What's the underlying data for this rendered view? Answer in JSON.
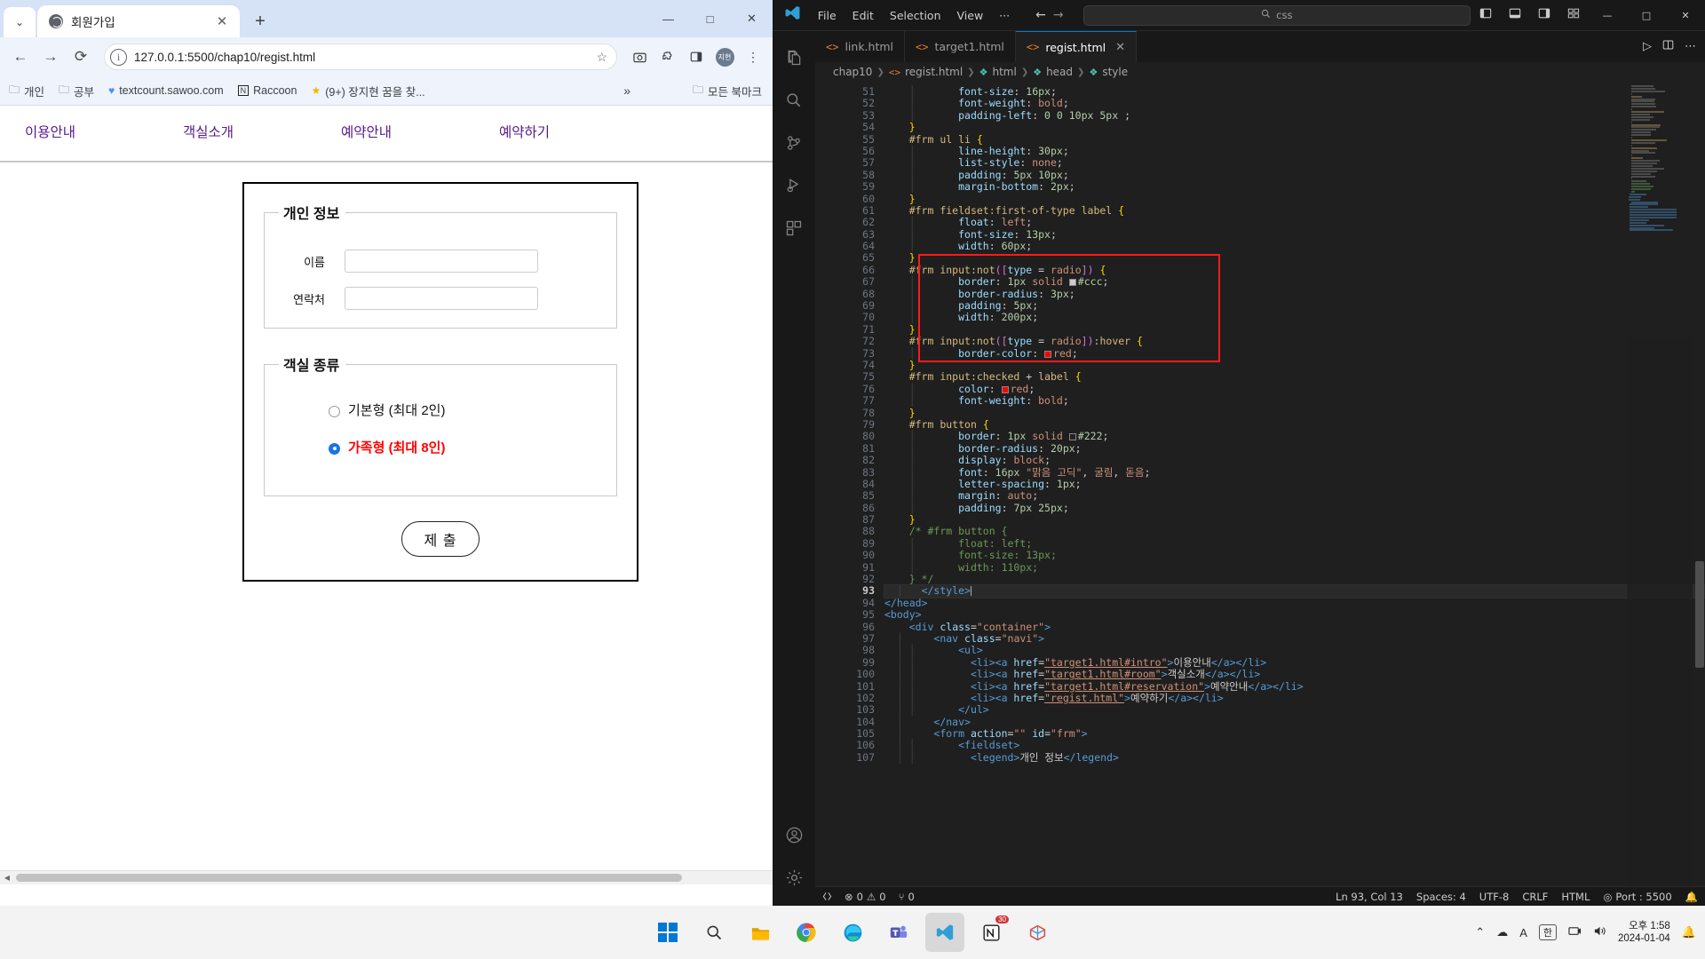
{
  "browser": {
    "tab": {
      "title": "회원가입",
      "favicon": "globe-icon",
      "close": "✕",
      "newtab": "+"
    },
    "window_controls": {
      "minimize": "—",
      "maximize": "□",
      "close": "✕"
    },
    "toolbar": {
      "back": "←",
      "forward": "→",
      "reload": "⟳",
      "url": "127.0.0.1:5500/chap10/regist.html",
      "secure_icon": "i",
      "star": "☆",
      "screenshot_icon": "camera-icon",
      "extensions_icon": "puzzle-icon",
      "sidepanel_icon": "panel-icon",
      "avatar": "지현",
      "menu": "⋮"
    },
    "bookmarks": [
      {
        "icon": "folder",
        "label": "개인"
      },
      {
        "icon": "folder",
        "label": "공부"
      },
      {
        "icon": "heart",
        "label": "textcount.sawoo.com"
      },
      {
        "icon": "notion",
        "label": "Raccoon"
      },
      {
        "icon": "star",
        "label": "(9+) 장지현 꿈을 찾..."
      }
    ],
    "bookmarks_more": "»",
    "all_bookmarks": "모든 북마크"
  },
  "page": {
    "nav": [
      {
        "label": "이용안내",
        "href": "target1.html#intro"
      },
      {
        "label": "객실소개",
        "href": "target1.html#room"
      },
      {
        "label": "예약안내",
        "href": "target1.html#reservation"
      },
      {
        "label": "예약하기",
        "href": "regist.html"
      }
    ],
    "fieldset_personal": {
      "legend": "개인 정보",
      "fields": [
        {
          "label": "이름",
          "value": "",
          "placeholder": ""
        },
        {
          "label": "연락처",
          "value": "",
          "placeholder": ""
        }
      ]
    },
    "fieldset_room": {
      "legend": "객실 종류",
      "options": [
        {
          "label": "기본형 (최대 2인)",
          "checked": false
        },
        {
          "label": "가족형 (최대 8인)",
          "checked": true
        }
      ]
    },
    "submit_label": "제 출"
  },
  "vscode": {
    "menu": [
      "File",
      "Edit",
      "Selection",
      "View",
      "···"
    ],
    "nav_back": "←",
    "nav_forward": "→",
    "search_placeholder": "css",
    "search_icon": "search-icon",
    "layout_icons": [
      "toggle-primary-sidebar-icon",
      "toggle-panel-icon",
      "toggle-secondary-sidebar-icon",
      "customize-layout-icon"
    ],
    "window_controls": {
      "minimize": "—",
      "maximize": "□",
      "close": "✕"
    },
    "activity_bar": [
      "explorer-icon",
      "search-icon",
      "source-control-icon",
      "run-and-debug-icon",
      "extensions-icon",
      "accounts-icon",
      "settings-gear-icon"
    ],
    "tabs": [
      {
        "label": "link.html",
        "active": false,
        "icon": "html-icon"
      },
      {
        "label": "target1.html",
        "active": false,
        "icon": "html-icon"
      },
      {
        "label": "regist.html",
        "active": true,
        "icon": "html-icon",
        "close": "✕"
      }
    ],
    "tab_actions": [
      "run-preview-icon",
      "split-editor-icon",
      "more-actions-icon"
    ],
    "breadcrumb": [
      "chap10",
      "regist.html",
      "html",
      "head",
      "style"
    ],
    "editor": {
      "first_line_number": 51,
      "current_line": 93,
      "lines": [
        {
          "n": 51,
          "html": "<span class=\"ind-guide\">    </span><span class=\"ind-guide\">│   </span><span class=\"k-prop\">    font-size</span><span class=\"k-punct\">: </span><span class=\"k-num\">16px</span><span class=\"k-punct\">;</span>"
        },
        {
          "n": 52,
          "html": "<span class=\"ind-guide\">    </span><span class=\"ind-guide\">│   </span><span class=\"k-prop\">    font-weight</span><span class=\"k-punct\">: </span><span class=\"k-val\">bold</span><span class=\"k-punct\">;</span>"
        },
        {
          "n": 53,
          "html": "<span class=\"ind-guide\">    </span><span class=\"ind-guide\">│   </span><span class=\"k-prop\">    padding-left</span><span class=\"k-punct\">: </span><span class=\"k-num\">0 0 10px 5px</span><span class=\"k-punct\"> ;</span>"
        },
        {
          "n": 54,
          "html": "<span class=\"ind-guide\">    </span><span class=\"k-brace\">}</span>"
        },
        {
          "n": 55,
          "html": "<span class=\"ind-guide\">    </span><span class=\"k-sel\">#frm ul li</span> <span class=\"k-brace\">{</span>"
        },
        {
          "n": 56,
          "html": "<span class=\"ind-guide\">    </span><span class=\"ind-guide\">│   </span><span class=\"k-prop\">    line-height</span><span class=\"k-punct\">: </span><span class=\"k-num\">30px</span><span class=\"k-punct\">;</span>"
        },
        {
          "n": 57,
          "html": "<span class=\"ind-guide\">    </span><span class=\"ind-guide\">│   </span><span class=\"k-prop\">    list-style</span><span class=\"k-punct\">: </span><span class=\"k-val\">none</span><span class=\"k-punct\">;</span>"
        },
        {
          "n": 58,
          "html": "<span class=\"ind-guide\">    </span><span class=\"ind-guide\">│   </span><span class=\"k-prop\">    padding</span><span class=\"k-punct\">: </span><span class=\"k-num\">5px 10px</span><span class=\"k-punct\">;</span>"
        },
        {
          "n": 59,
          "html": "<span class=\"ind-guide\">    </span><span class=\"ind-guide\">│   </span><span class=\"k-prop\">    margin-bottom</span><span class=\"k-punct\">: </span><span class=\"k-num\">2px</span><span class=\"k-punct\">;</span>"
        },
        {
          "n": 60,
          "html": "<span class=\"ind-guide\">    </span><span class=\"k-brace\">}</span>"
        },
        {
          "n": 61,
          "html": "<span class=\"ind-guide\">    </span><span class=\"k-sel\">#frm fieldset</span><span class=\"k-pseudo\">:first-of-type</span> <span class=\"k-sel\">label</span> <span class=\"k-brace\">{</span>"
        },
        {
          "n": 62,
          "html": "<span class=\"ind-guide\">    </span><span class=\"ind-guide\">│   </span><span class=\"k-prop\">    float</span><span class=\"k-punct\">: </span><span class=\"k-val\">left</span><span class=\"k-punct\">;</span>"
        },
        {
          "n": 63,
          "html": "<span class=\"ind-guide\">    </span><span class=\"ind-guide\">│   </span><span class=\"k-prop\">    font-size</span><span class=\"k-punct\">: </span><span class=\"k-num\">13px</span><span class=\"k-punct\">;</span>"
        },
        {
          "n": 64,
          "html": "<span class=\"ind-guide\">    </span><span class=\"ind-guide\">│   </span><span class=\"k-prop\">    width</span><span class=\"k-punct\">: </span><span class=\"k-num\">60px</span><span class=\"k-punct\">;</span>"
        },
        {
          "n": 65,
          "html": "<span class=\"ind-guide\">    </span><span class=\"k-brace\">}</span>"
        },
        {
          "n": 66,
          "html": "<span class=\"ind-guide\">    </span><span class=\"k-sel\">#frm input</span><span class=\"k-pseudo\">:not</span><span class=\"k-br2\">(</span><span class=\"k-br2\">[</span><span class=\"k-prop\">type</span> <span class=\"k-punct\">=</span> <span class=\"k-val\">radio</span><span class=\"k-br2\">]</span><span class=\"k-br2\">)</span> <span class=\"k-brace\">{</span>"
        },
        {
          "n": 67,
          "html": "<span class=\"ind-guide\">    </span><span class=\"ind-guide\">│   </span><span class=\"k-prop\">    border</span><span class=\"k-punct\">: </span><span class=\"k-num\">1px</span> <span class=\"k-val\">solid</span> <span class=\"swatch\" style=\"background:#ccc\"></span><span class=\"k-num\">#ccc</span><span class=\"k-punct\">;</span>"
        },
        {
          "n": 68,
          "html": "<span class=\"ind-guide\">    </span><span class=\"ind-guide\">│   </span><span class=\"k-prop\">    border-radius</span><span class=\"k-punct\">: </span><span class=\"k-num\">3px</span><span class=\"k-punct\">;</span>"
        },
        {
          "n": 69,
          "html": "<span class=\"ind-guide\">    </span><span class=\"ind-guide\">│   </span><span class=\"k-prop\">    padding</span><span class=\"k-punct\">: </span><span class=\"k-num\">5px</span><span class=\"k-punct\">;</span>"
        },
        {
          "n": 70,
          "html": "<span class=\"ind-guide\">    </span><span class=\"ind-guide\">│   </span><span class=\"k-prop\">    width</span><span class=\"k-punct\">: </span><span class=\"k-num\">200px</span><span class=\"k-punct\">;</span>"
        },
        {
          "n": 71,
          "html": "<span class=\"ind-guide\">    </span><span class=\"k-brace\">}</span>"
        },
        {
          "n": 72,
          "html": "<span class=\"ind-guide\">    </span><span class=\"k-sel\">#frm input</span><span class=\"k-pseudo\">:not</span><span class=\"k-br2\">(</span><span class=\"k-br2\">[</span><span class=\"k-prop\">type</span> <span class=\"k-punct\">=</span> <span class=\"k-val\">radio</span><span class=\"k-br2\">]</span><span class=\"k-br2\">)</span><span class=\"k-pseudo\">:hover</span> <span class=\"k-brace\">{</span>"
        },
        {
          "n": 73,
          "html": "<span class=\"ind-guide\">    </span><span class=\"ind-guide\">│   </span><span class=\"k-prop\">    border-color</span><span class=\"k-punct\">: </span><span class=\"swatch\" style=\"background:#ff0000\"></span><span class=\"k-val\">red</span><span class=\"k-punct\">;</span>"
        },
        {
          "n": 74,
          "html": "<span class=\"ind-guide\">    </span><span class=\"k-brace\">}</span>"
        },
        {
          "n": 75,
          "html": "<span class=\"ind-guide\">    </span><span class=\"k-sel\">#frm input</span><span class=\"k-pseudo\">:checked</span> <span class=\"k-punct\">+</span> <span class=\"k-sel\">label</span> <span class=\"k-brace\">{</span>"
        },
        {
          "n": 76,
          "html": "<span class=\"ind-guide\">    </span><span class=\"ind-guide\">│   </span><span class=\"k-prop\">    color</span><span class=\"k-punct\">: </span><span class=\"swatch\" style=\"background:#ff0000\"></span><span class=\"k-val\">red</span><span class=\"k-punct\">;</span>"
        },
        {
          "n": 77,
          "html": "<span class=\"ind-guide\">    </span><span class=\"ind-guide\">│   </span><span class=\"k-prop\">    font-weight</span><span class=\"k-punct\">: </span><span class=\"k-val\">bold</span><span class=\"k-punct\">;</span>"
        },
        {
          "n": 78,
          "html": "<span class=\"ind-guide\">    </span><span class=\"k-brace\">}</span>"
        },
        {
          "n": 79,
          "html": "<span class=\"ind-guide\">    </span><span class=\"k-sel\">#frm button</span> <span class=\"k-brace\">{</span>"
        },
        {
          "n": 80,
          "html": "<span class=\"ind-guide\">    </span><span class=\"ind-guide\">│   </span><span class=\"k-prop\">    border</span><span class=\"k-punct\">: </span><span class=\"k-num\">1px</span> <span class=\"k-val\">solid</span> <span class=\"swatch\" style=\"background:#222\"></span><span class=\"k-num\">#222</span><span class=\"k-punct\">;</span>"
        },
        {
          "n": 81,
          "html": "<span class=\"ind-guide\">    </span><span class=\"ind-guide\">│   </span><span class=\"k-prop\">    border-radius</span><span class=\"k-punct\">: </span><span class=\"k-num\">20px</span><span class=\"k-punct\">;</span>"
        },
        {
          "n": 82,
          "html": "<span class=\"ind-guide\">    </span><span class=\"ind-guide\">│   </span><span class=\"k-prop\">    display</span><span class=\"k-punct\">: </span><span class=\"k-val\">block</span><span class=\"k-punct\">;</span>"
        },
        {
          "n": 83,
          "html": "<span class=\"ind-guide\">    </span><span class=\"ind-guide\">│   </span><span class=\"k-prop\">    font</span><span class=\"k-punct\">: </span><span class=\"k-num\">16px</span> <span class=\"k-str\">\"맑음 고딕\"</span><span class=\"k-punct\">, </span><span class=\"k-val\">굴림</span><span class=\"k-punct\">, </span><span class=\"k-val\">돋음</span><span class=\"k-punct\">;</span>"
        },
        {
          "n": 84,
          "html": "<span class=\"ind-guide\">    </span><span class=\"ind-guide\">│   </span><span class=\"k-prop\">    letter-spacing</span><span class=\"k-punct\">: </span><span class=\"k-num\">1px</span><span class=\"k-punct\">;</span>"
        },
        {
          "n": 85,
          "html": "<span class=\"ind-guide\">    </span><span class=\"ind-guide\">│   </span><span class=\"k-prop\">    margin</span><span class=\"k-punct\">: </span><span class=\"k-val\">auto</span><span class=\"k-punct\">;</span>"
        },
        {
          "n": 86,
          "html": "<span class=\"ind-guide\">    </span><span class=\"ind-guide\">│   </span><span class=\"k-prop\">    padding</span><span class=\"k-punct\">: </span><span class=\"k-num\">7px 25px</span><span class=\"k-punct\">;</span>"
        },
        {
          "n": 87,
          "html": "<span class=\"ind-guide\">    </span><span class=\"k-brace\">}</span>"
        },
        {
          "n": 88,
          "html": "<span class=\"ind-guide\">    </span><span class=\"k-com\">/* #frm button {</span>"
        },
        {
          "n": 89,
          "html": "<span class=\"ind-guide\">    </span><span class=\"ind-guide\">│   </span><span class=\"k-com\">    float: left;</span>"
        },
        {
          "n": 90,
          "html": "<span class=\"ind-guide\">    </span><span class=\"ind-guide\">│   </span><span class=\"k-com\">    font-size: 13px;</span>"
        },
        {
          "n": 91,
          "html": "<span class=\"ind-guide\">    </span><span class=\"ind-guide\">│   </span><span class=\"k-com\">    width: 110px;</span>"
        },
        {
          "n": 92,
          "html": "<span class=\"ind-guide\">    </span><span class=\"k-com\">} */</span>"
        },
        {
          "n": 93,
          "html": "<span class=\"ind-guide\">  │ </span><span class=\"k-punct\">  </span><span class=\"k-tag\">&lt;/style&gt;</span><span class=\"cursor\"></span>",
          "current": true
        },
        {
          "n": 94,
          "html": "<span class=\"k-tag\">&lt;/head&gt;</span>"
        },
        {
          "n": 95,
          "html": "<span class=\"k-tag\">&lt;body&gt;</span>"
        },
        {
          "n": 96,
          "html": "<span class=\"ind-guide\">  </span>  <span class=\"k-tag\">&lt;div </span><span class=\"k-attr\">class</span><span class=\"k-punct\">=</span><span class=\"k-str\">\"container\"</span><span class=\"k-tag\">&gt;</span>"
        },
        {
          "n": 97,
          "html": "<span class=\"ind-guide\">  │ </span>    <span class=\"k-tag\">&lt;nav </span><span class=\"k-attr\">class</span><span class=\"k-punct\">=</span><span class=\"k-str\">\"navi\"</span><span class=\"k-tag\">&gt;</span>"
        },
        {
          "n": 98,
          "html": "<span class=\"ind-guide\">  │ </span><span class=\"ind-guide\">│   </span>    <span class=\"k-tag\">&lt;ul&gt;</span>"
        },
        {
          "n": 99,
          "html": "<span class=\"ind-guide\">  │ </span><span class=\"ind-guide\">│   </span>      <span class=\"k-tag\">&lt;li&gt;&lt;a </span><span class=\"k-attr\">href</span><span class=\"k-punct\">=</span><span class=\"k-str\" style=\"text-decoration:underline\">\"target1.html#intro\"</span><span class=\"k-tag\">&gt;</span>이용안내<span class=\"k-tag\">&lt;/a&gt;&lt;/li&gt;</span>"
        },
        {
          "n": 100,
          "html": "<span class=\"ind-guide\">  │ </span><span class=\"ind-guide\">│   </span>      <span class=\"k-tag\">&lt;li&gt;&lt;a </span><span class=\"k-attr\">href</span><span class=\"k-punct\">=</span><span class=\"k-str\" style=\"text-decoration:underline\">\"target1.html#room\"</span><span class=\"k-tag\">&gt;</span>객실소개<span class=\"k-tag\">&lt;/a&gt;&lt;/li&gt;</span>"
        },
        {
          "n": 101,
          "html": "<span class=\"ind-guide\">  │ </span><span class=\"ind-guide\">│   </span>      <span class=\"k-tag\">&lt;li&gt;&lt;a </span><span class=\"k-attr\">href</span><span class=\"k-punct\">=</span><span class=\"k-str\" style=\"text-decoration:underline\">\"target1.html#reservation\"</span><span class=\"k-tag\">&gt;</span>예약안내<span class=\"k-tag\">&lt;/a&gt;&lt;/li&gt;</span>"
        },
        {
          "n": 102,
          "html": "<span class=\"ind-guide\">  │ </span><span class=\"ind-guide\">│   </span>      <span class=\"k-tag\">&lt;li&gt;&lt;a </span><span class=\"k-attr\">href</span><span class=\"k-punct\">=</span><span class=\"k-str\" style=\"text-decoration:underline\">\"regist.html\"</span><span class=\"k-tag\">&gt;</span>예약하기<span class=\"k-tag\">&lt;/a&gt;&lt;/li&gt;</span>"
        },
        {
          "n": 103,
          "html": "<span class=\"ind-guide\">  │ </span><span class=\"ind-guide\">│   </span>    <span class=\"k-tag\">&lt;/ul&gt;</span>"
        },
        {
          "n": 104,
          "html": "<span class=\"ind-guide\">  │ </span>    <span class=\"k-tag\">&lt;/nav&gt;</span>"
        },
        {
          "n": 105,
          "html": "<span class=\"ind-guide\">  │ </span>    <span class=\"k-tag\">&lt;form </span><span class=\"k-attr\">action</span><span class=\"k-punct\">=</span><span class=\"k-str\">\"\"</span> <span class=\"k-attr\">id</span><span class=\"k-punct\">=</span><span class=\"k-str\">\"frm\"</span><span class=\"k-tag\">&gt;</span>"
        },
        {
          "n": 106,
          "html": "<span class=\"ind-guide\">  │ </span><span class=\"ind-guide\">│   </span>    <span class=\"k-tag\">&lt;fieldset&gt;</span>"
        },
        {
          "n": 107,
          "html": "<span class=\"ind-guide\">  │ </span><span class=\"ind-guide\">│   </span>      <span class=\"k-tag\">&lt;legend&gt;</span>개인 정보<span class=\"k-tag\">&lt;/legend&gt;</span>"
        }
      ]
    },
    "statusbar": {
      "remote_icon": "remote-icon",
      "errors": "0",
      "warnings": "0",
      "ports": "0",
      "line_col": "Ln 93, Col 13",
      "spaces": "Spaces: 4",
      "encoding": "UTF-8",
      "eol": "CRLF",
      "language": "HTML",
      "live_server": "Port : 5500",
      "bell_icon": "bell-icon"
    }
  },
  "taskbar": {
    "apps": [
      "start-windows-icon",
      "search-icon",
      "file-explorer-icon",
      "chrome-icon",
      "edge-icon",
      "teams-icon",
      "vscode-icon",
      "notion-icon",
      "sketchup-icon"
    ],
    "notion_badge": "30",
    "tray": [
      "show-hidden-icons",
      "cloud-icon",
      "ime-A-icon",
      "ime-korean-icon",
      "network-icon",
      "volume-icon"
    ],
    "ime_a": "A",
    "ime_ko": "한",
    "clock_time": "오후 1:58",
    "clock_date": "2024-01-04",
    "notification_icon": "bell-icon"
  }
}
